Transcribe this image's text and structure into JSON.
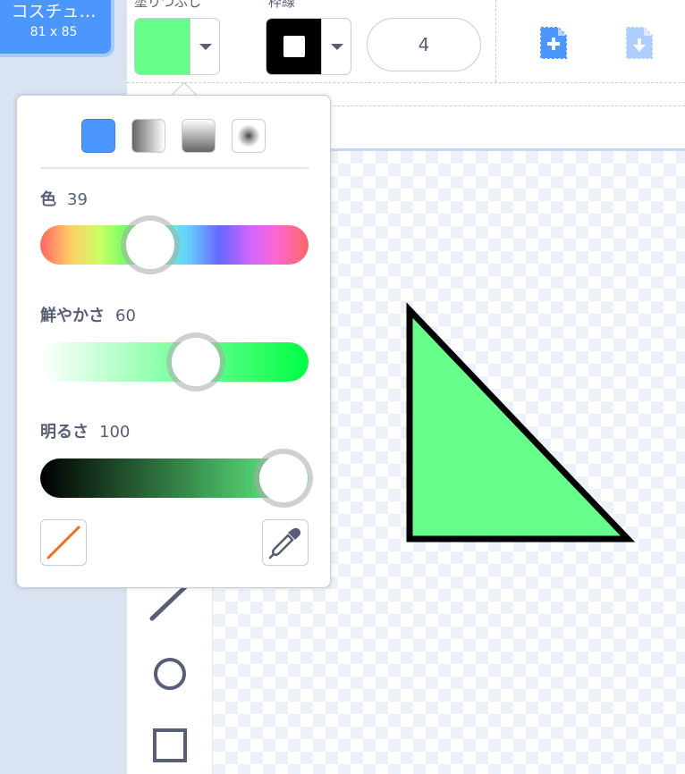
{
  "costume": {
    "name": "コスチュ…",
    "size": "81 x 85"
  },
  "toolbar": {
    "fill_label": "塗りつぶし",
    "outline_label": "枠線",
    "fill_color": "#66ff8c",
    "outline_color": "#000000",
    "stroke_width": "4",
    "new_icon": "add-file-icon",
    "import_icon": "download-file-icon"
  },
  "color_picker": {
    "modes": [
      "solid",
      "horizontal-gradient",
      "vertical-gradient",
      "radial-gradient"
    ],
    "selected_mode": "solid",
    "hue": {
      "label": "色",
      "value": "39"
    },
    "saturation": {
      "label": "鮮やかさ",
      "value": "60"
    },
    "brightness": {
      "label": "明るさ",
      "value": "100"
    },
    "hue_fraction": 0.39,
    "saturation_fraction": 0.6,
    "brightness_fraction": 1.0
  },
  "tools": [
    "line-icon",
    "circle-icon",
    "rectangle-icon"
  ],
  "canvas": {
    "shape": "triangle",
    "fill": "#66ff8c",
    "stroke": "#000000"
  }
}
